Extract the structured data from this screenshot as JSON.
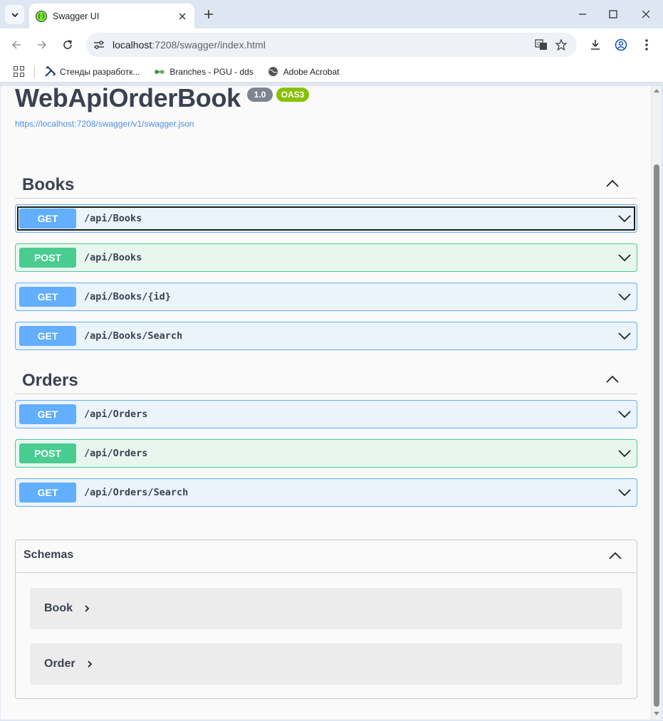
{
  "browser": {
    "tab_title": "Swagger UI",
    "url_host": "localhost",
    "url_rest": ":7208/swagger/index.html",
    "bookmarks": [
      {
        "label": "Стенды разработк...",
        "icon": "tools-icon"
      },
      {
        "label": "Branches - PGU - dds",
        "icon": "gitlab-branch-icon"
      },
      {
        "label": "Adobe Acrobat",
        "icon": "globe-icon"
      }
    ]
  },
  "api": {
    "title": "WebApiOrderBook",
    "version": "1.0",
    "oas": "OAS3",
    "spec_url": "https://localhost:7208/swagger/v1/swagger.json"
  },
  "tags": [
    {
      "name": "Books",
      "operations": [
        {
          "method": "GET",
          "path": "/api/Books"
        },
        {
          "method": "POST",
          "path": "/api/Books"
        },
        {
          "method": "GET",
          "path": "/api/Books/{id}"
        },
        {
          "method": "GET",
          "path": "/api/Books/Search"
        }
      ]
    },
    {
      "name": "Orders",
      "operations": [
        {
          "method": "GET",
          "path": "/api/Orders"
        },
        {
          "method": "POST",
          "path": "/api/Orders"
        },
        {
          "method": "GET",
          "path": "/api/Orders/Search"
        }
      ]
    }
  ],
  "schemas": {
    "title": "Schemas",
    "models": [
      "Book",
      "Order"
    ]
  },
  "colors": {
    "get": "#61affe",
    "post": "#49cc90",
    "text": "#3b4151",
    "link": "#4990e2"
  }
}
